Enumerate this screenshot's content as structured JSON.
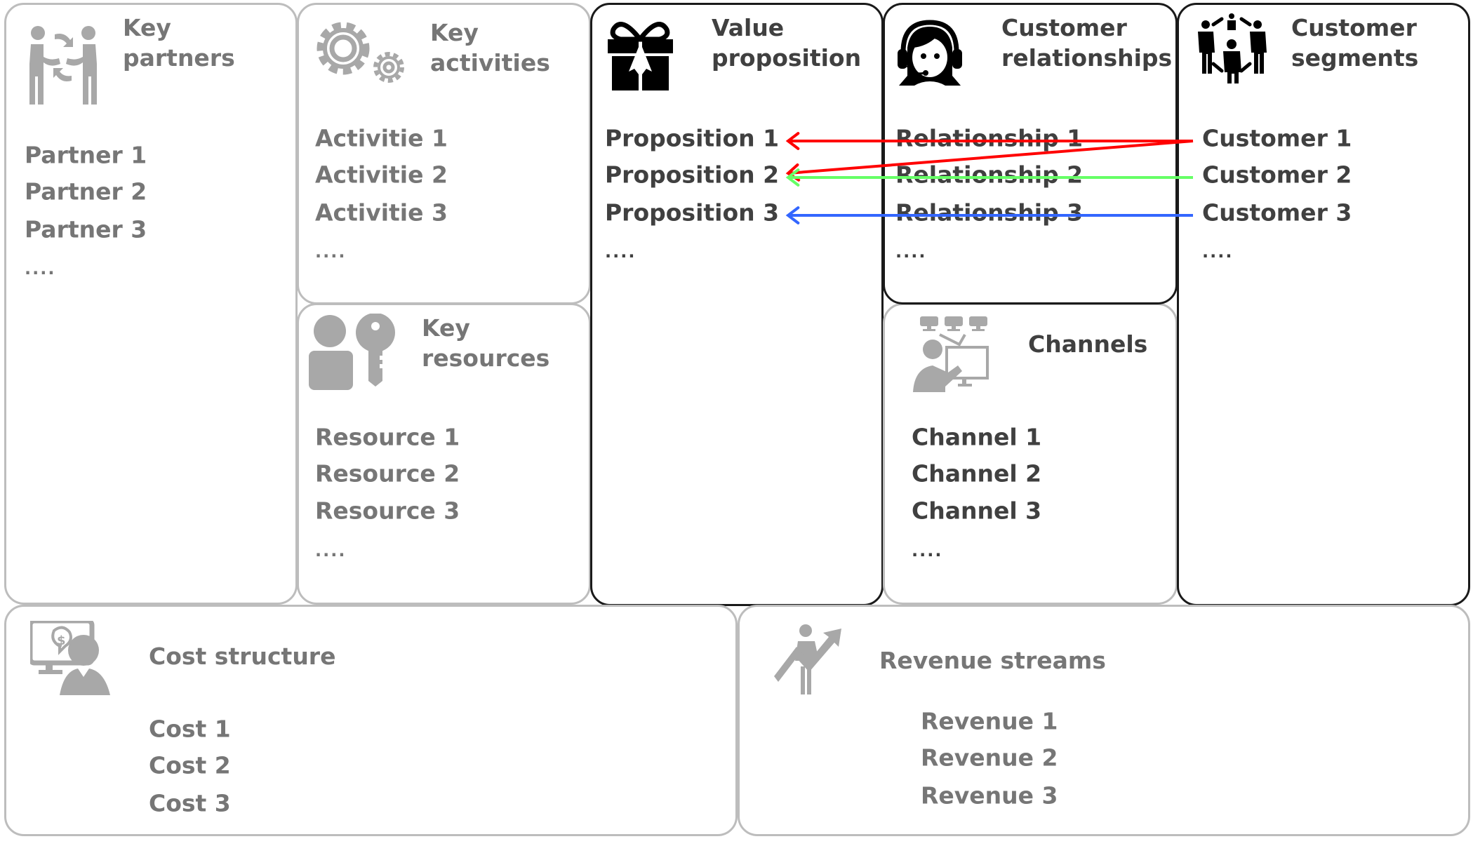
{
  "canvas": {
    "key_partners": {
      "title": [
        "Key",
        "partners"
      ],
      "icon": "handshake-partners-icon",
      "items": [
        "Partner 1",
        "Partner 2",
        "Partner 3",
        "...."
      ]
    },
    "key_activities": {
      "title": [
        "Key",
        "activities"
      ],
      "icon": "gears-icon",
      "items": [
        "Activitie 1",
        "Activitie 2",
        "Activitie 3",
        "...."
      ]
    },
    "key_resources": {
      "title": [
        "Key",
        "resources"
      ],
      "icon": "person-key-icon",
      "items": [
        "Resource 1",
        "Resource 2",
        "Resource 3",
        "...."
      ]
    },
    "value_proposition": {
      "title": [
        "Value",
        "proposition"
      ],
      "icon": "gift-icon",
      "items": [
        "Proposition 1",
        "Proposition 2",
        "Proposition 3",
        "...."
      ]
    },
    "customer_relationships": {
      "title": [
        "Customer",
        "relationships"
      ],
      "icon": "headset-agent-icon",
      "items": [
        "Relationship 1",
        "Relationship 2",
        "Relationship 3",
        "...."
      ]
    },
    "channels": {
      "title": [
        "Channels"
      ],
      "icon": "presenter-monitors-icon",
      "items": [
        "Channel 1",
        "Channel 2",
        "Channel 3",
        "...."
      ]
    },
    "customer_segments": {
      "title": [
        "Customer",
        "segments"
      ],
      "icon": "people-group-icon",
      "items": [
        "Customer 1",
        "Customer 2",
        "Customer 3",
        "...."
      ]
    },
    "cost_structure": {
      "title": [
        "Cost structure"
      ],
      "icon": "cost-person-monitor-icon",
      "items": [
        "Cost 1",
        "Cost 2",
        "Cost 3"
      ]
    },
    "revenue_streams": {
      "title": [
        "Revenue streams"
      ],
      "icon": "growth-arrow-person-icon",
      "items": [
        "Revenue 1",
        "Revenue 2",
        "Revenue 3"
      ]
    }
  },
  "links": [
    {
      "from": "Customer 1",
      "to": "Proposition 1",
      "color": "#ff0000"
    },
    {
      "from": "Customer 1",
      "to": "Proposition 2",
      "color": "#ff0000"
    },
    {
      "from": "Customer 2",
      "to": "Proposition 2",
      "color": "#66ff66"
    },
    {
      "from": "Customer 3",
      "to": "Proposition 3",
      "color": "#3366ff"
    }
  ],
  "colors": {
    "text_light": "#767676",
    "text_dark": "#404040",
    "icon_light": "#a8a8a8",
    "icon_dark": "#000000",
    "border_light": "#bdbdbd",
    "border_dark": "#1a1a1a"
  }
}
